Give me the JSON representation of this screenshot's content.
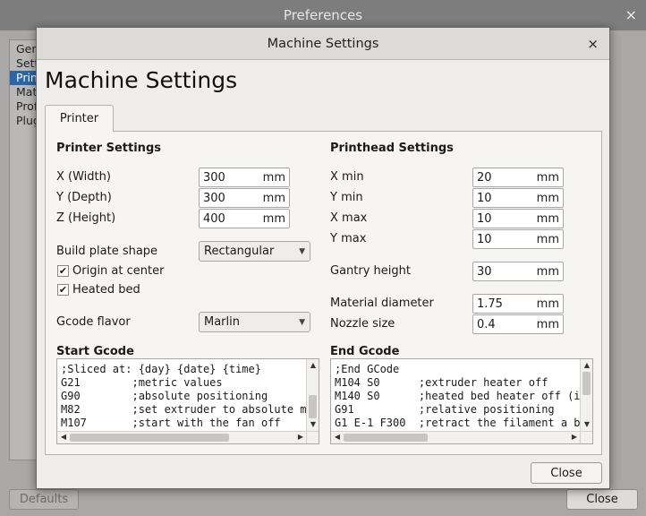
{
  "preferences": {
    "title": "Preferences",
    "close_glyph": "×",
    "sidebar": [
      "General",
      "Settings",
      "Printers",
      "Materials",
      "Profiles",
      "Plugins"
    ],
    "defaults_label": "Defaults",
    "close_label": "Close"
  },
  "dialog": {
    "title": "Machine Settings",
    "close_glyph": "×",
    "heading": "Machine Settings",
    "tab": "Printer",
    "close_label": "Close",
    "printer_settings": {
      "title": "Printer Settings",
      "width": {
        "label": "X (Width)",
        "value": "300",
        "unit": "mm"
      },
      "depth": {
        "label": "Y (Depth)",
        "value": "300",
        "unit": "mm"
      },
      "height": {
        "label": "Z (Height)",
        "value": "400",
        "unit": "mm"
      },
      "build_plate": {
        "label": "Build plate shape",
        "value": "Rectangular"
      },
      "origin_center": {
        "label": "Origin at center",
        "checked": "✔"
      },
      "heated_bed": {
        "label": "Heated bed",
        "checked": "✔"
      },
      "gcode_flavor": {
        "label": "Gcode flavor",
        "value": "Marlin"
      }
    },
    "printhead_settings": {
      "title": "Printhead Settings",
      "x_min": {
        "label": "X min",
        "value": "20",
        "unit": "mm"
      },
      "y_min": {
        "label": "Y min",
        "value": "10",
        "unit": "mm"
      },
      "x_max": {
        "label": "X max",
        "value": "10",
        "unit": "mm"
      },
      "y_max": {
        "label": "Y max",
        "value": "10",
        "unit": "mm"
      },
      "gantry_height": {
        "label": "Gantry height",
        "value": "30",
        "unit": "mm"
      },
      "material_diameter": {
        "label": "Material diameter",
        "value": "1.75",
        "unit": "mm"
      },
      "nozzle_size": {
        "label": "Nozzle size",
        "value": "0.4",
        "unit": "mm"
      }
    },
    "start_gcode": {
      "title": "Start Gcode",
      "lines": [
        ";Sliced at: {day} {date} {time}",
        "G21        ;metric values",
        "G90        ;absolute positioning",
        "M82        ;set extruder to absolute m",
        "M107       ;start with the fan off"
      ]
    },
    "end_gcode": {
      "title": "End Gcode",
      "lines": [
        ";End GCode",
        "M104 S0      ;extruder heater off",
        "M140 S0      ;heated bed heater off (i",
        "G91          ;relative positioning",
        "G1 E-1 F300  ;retract the filament a b"
      ]
    }
  }
}
